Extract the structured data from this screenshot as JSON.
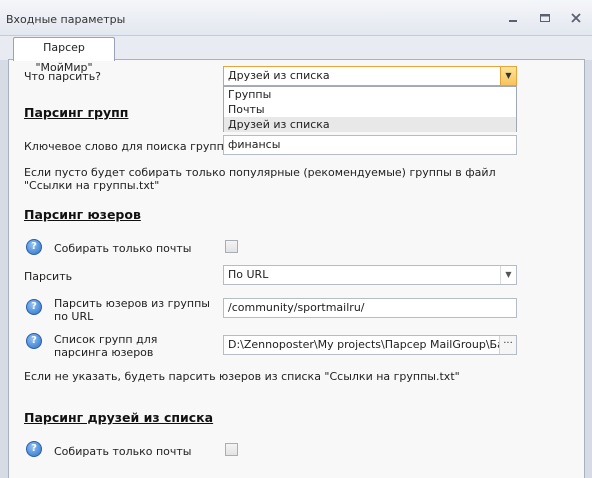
{
  "window": {
    "title": "Входные параметры",
    "controls": {
      "minimize": "minimize-icon",
      "restore": "restore-icon",
      "close": "close-icon"
    }
  },
  "tabs": [
    {
      "label": "Парсер \"МойМир\"",
      "active": true
    }
  ],
  "what_to_parse": {
    "label": "Что парсить?",
    "value": "Друзей из списка",
    "options": [
      "Группы",
      "Почты",
      "Друзей из списка"
    ],
    "selected_option": "Друзей из списка"
  },
  "group_parsing": {
    "heading": "Парсинг групп",
    "keyword_label": "Ключевое слово для поиска групп",
    "keyword_value": "финансы",
    "note": "Если пусто будет собирать только популярные (рекомендуемые) группы в файл \"Ссылки на группы.txt\""
  },
  "user_parsing": {
    "heading": "Парсинг юзеров",
    "emails_only_label": "Собирать только почты",
    "emails_only_checked": false,
    "parse_label": "Парсить",
    "parse_value": "По URL",
    "group_url_label": "Парсить юзеров из группы по URL",
    "group_url_value": "/community/sportmailru/",
    "group_list_label": "Список групп для парсинга юзеров",
    "group_list_value": "D:\\Zennoposter\\My projects\\Парсер MailGroup\\Базы ссылок",
    "browse_label": "···",
    "note": "Если не указать, будеть парсить юзеров из списка \"Ссылки на группы.txt\""
  },
  "friends_parsing": {
    "heading": "Парсинг друзей из списка",
    "emails_only_label": "Собирать только почты",
    "emails_only_checked": false
  },
  "icons": {
    "help": "help-icon",
    "dropdown": "chevron-down-icon"
  },
  "colors": {
    "accent_dropdown": "#f7c35b",
    "help_icon": "#2d72c9"
  }
}
